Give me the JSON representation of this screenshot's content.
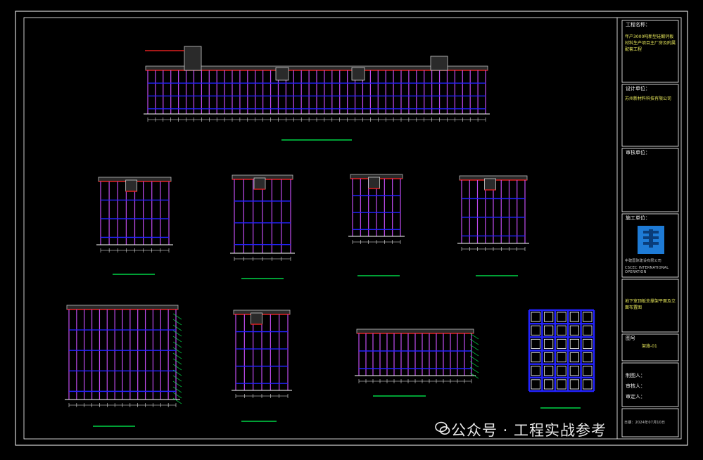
{
  "titleblock": {
    "project_label": "工程名称：",
    "project_name": "年产3000吨新型硅酸钙板材料生产项目主厂房及附属配套工程",
    "designer_label": "设计单位：",
    "designer_name": "苏州新材料科技有限公司",
    "review_label": "审核单位：",
    "construction_label": "施工单位：",
    "company_name": "中建国际建设有限公司",
    "company_en": "CSCEC INTERNATIONAL OPERATION",
    "drawing_title": "地下室顶板支撑架平面及立面布置图",
    "drawing_no_label": "图号",
    "drawing_no": "架施-01",
    "drawn_by": "制图人：",
    "checked_by": "审核人：",
    "approved_by": "审定人：",
    "date": "日期：2024年07月10日"
  },
  "watermark": {
    "text": "公众号 · 工程实战参考"
  },
  "colors": {
    "background": "#000000",
    "frame": "#ffffff",
    "vertical_pole": "#c24cf0",
    "horizontal_bar": "#2323ff",
    "slab": "#e02020",
    "dim_green": "#00ff55",
    "text": "#ffffff"
  }
}
